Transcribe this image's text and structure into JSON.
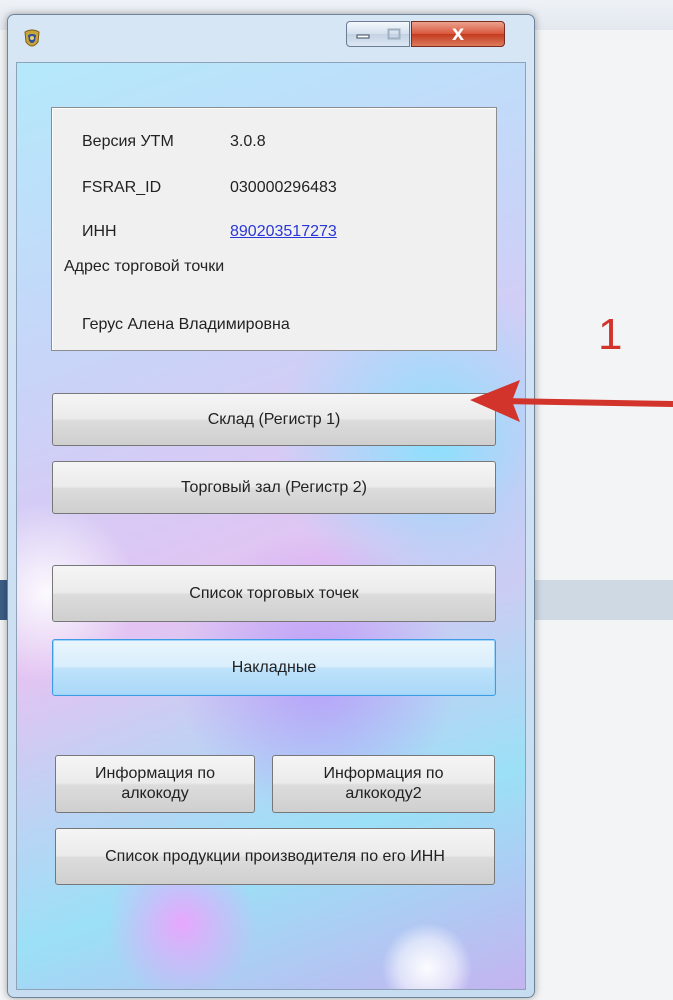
{
  "window": {
    "close_glyph": "X"
  },
  "info": {
    "version_label": "Версия УТМ",
    "version_value": "3.0.8",
    "fsrar_label": "FSRAR_ID",
    "fsrar_value": "030000296483",
    "inn_label": "ИНН",
    "inn_value": "890203517273",
    "address_label": "Адрес торговой точки",
    "owner_name": "Герус Алена Владимировна"
  },
  "buttons": {
    "warehouse": "Склад (Регистр 1)",
    "trade_hall": "Торговый зал (Регистр 2)",
    "outlets_list": "Список торговых точек",
    "invoices": "Накладные",
    "alcocode_info_line1": "Информация по",
    "alcocode_info_line2": "алкокоду",
    "alcocode2_info_line1": "Информация по",
    "alcocode2_info_line2": "алкокоду2",
    "producer_products": "Список продукции производителя по его ИНН"
  },
  "annotation": {
    "number": "1",
    "color": "#d2342c"
  },
  "colors": {
    "link": "#2a37d6",
    "close_button": "#c33a1f",
    "focus_border": "#3c9be4"
  }
}
